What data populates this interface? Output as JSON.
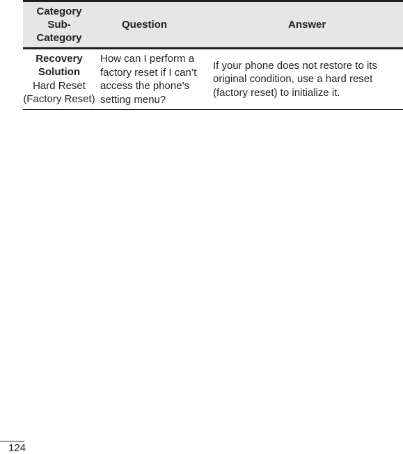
{
  "table": {
    "headers": {
      "category": "Category",
      "sub_category": "Sub-\nCategory",
      "question": "Question",
      "answer": "Answer"
    },
    "rows": [
      {
        "category": "Recovery Solution",
        "sub_category": "Hard Reset (Factory Reset)",
        "question": "How can I perform a factory reset if I can’t access the phone’s setting menu?",
        "answer": "If your phone does not restore to its original condition, use a hard reset (factory reset) to initialize it."
      }
    ]
  },
  "footer": {
    "page_number": "124"
  }
}
